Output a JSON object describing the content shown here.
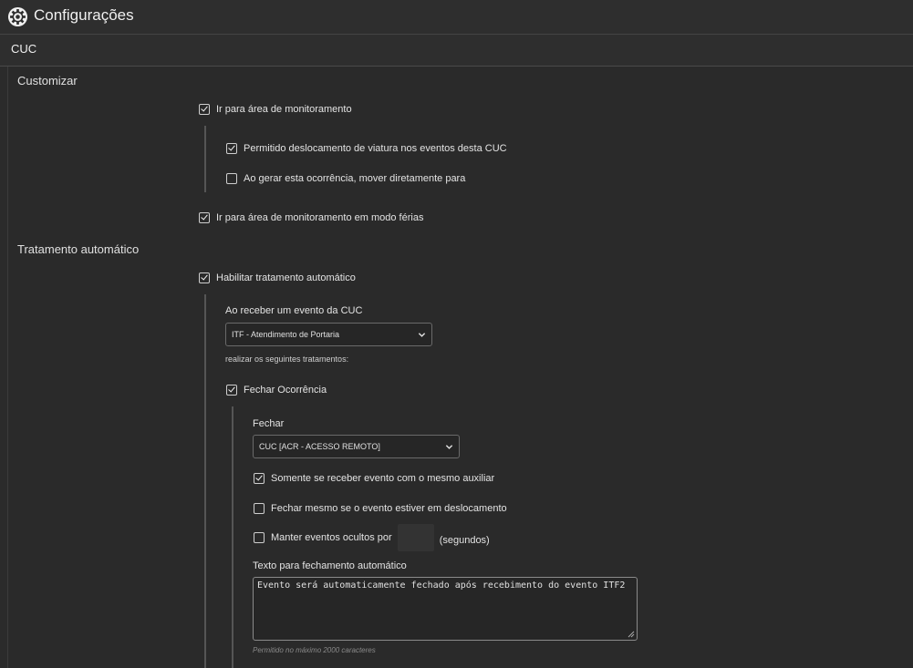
{
  "header": {
    "title": "Configurações",
    "icon": "gear-icon"
  },
  "section": {
    "title": "CUC"
  },
  "customizar": {
    "title": "Customizar",
    "ir_monitoramento": {
      "label": "Ir para área de monitoramento",
      "checked": true
    },
    "permitido_deslocamento": {
      "label": "Permitido deslocamento de viatura nos eventos desta CUC",
      "checked": true
    },
    "mover_diretamente": {
      "label": "Ao gerar esta ocorrência, mover diretamente para",
      "checked": false
    },
    "modo_ferias": {
      "label": "Ir para área de monitoramento em modo férias",
      "checked": true
    }
  },
  "tratamento": {
    "title": "Tratamento automático",
    "habilitar": {
      "label": "Habilitar tratamento automático",
      "checked": true
    },
    "receber_label": "Ao receber um evento da CUC",
    "evento_select": "ITF - Atendimento de Portaria",
    "realizar_label": "realizar os seguintes tratamentos:",
    "fechar_ocorrencia": {
      "label": "Fechar Ocorrência",
      "checked": true
    },
    "fechar_label": "Fechar",
    "fechar_select": "CUC [ACR - ACESSO REMOTO]",
    "mesmo_auxiliar": {
      "label": "Somente se receber evento com o mesmo auxiliar",
      "checked": true
    },
    "em_deslocamento": {
      "label": "Fechar mesmo se o evento estiver em deslocamento",
      "checked": false
    },
    "manter_ocultos": {
      "label": "Manter eventos ocultos por",
      "checked": false,
      "value": "",
      "suffix": "(segundos)"
    },
    "texto_label": "Texto para fechamento automático",
    "texto_value": "Evento será automaticamente fechado após recebimento do evento ITF2",
    "texto_hint": "Permitido no máximo 2000 caracteres"
  }
}
